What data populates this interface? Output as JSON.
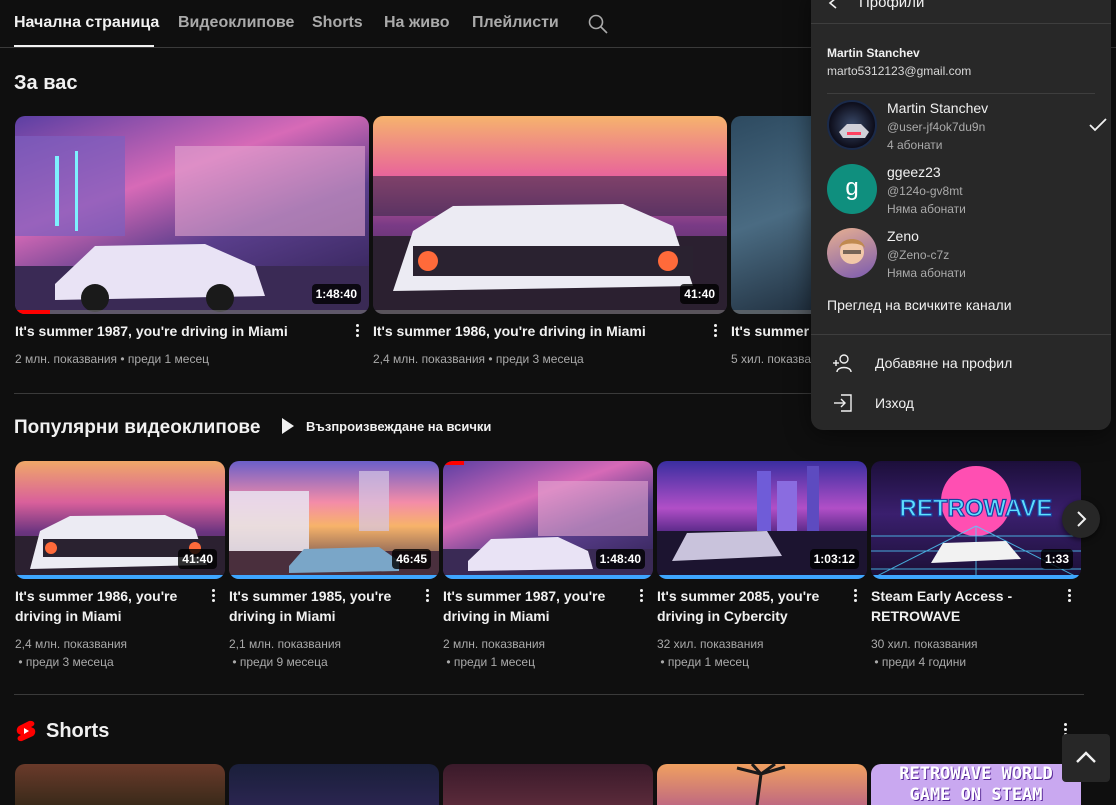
{
  "tabs": [
    "Начална страница",
    "Видеоклипове",
    "Shorts",
    "На живо",
    "Плейлисти"
  ],
  "sections": {
    "for_you": "За вас",
    "popular": "Популярни видеоклипове",
    "play_all": "Възпроизвеждане на всички",
    "shorts": "Shorts"
  },
  "for_you_videos": [
    {
      "title": "It's summer 1987, you're driving in Miami",
      "views": "2 млн. показвания",
      "age": "преди 1 месец",
      "duration": "1:48:40",
      "progress": 0.1
    },
    {
      "title": "It's summer 1986, you're driving in Miami",
      "views": "2,4 млн. показвания",
      "age": "преди 3 месеца",
      "duration": "41:40",
      "progress": 0
    },
    {
      "title": "It's summer 1",
      "views": "5 хил. показва",
      "age": "",
      "duration": "",
      "progress": 0
    }
  ],
  "popular_videos": [
    {
      "title1": "It's summer 1986, you're",
      "title2": "driving in Miami",
      "views": "2,4 млн. показвания",
      "age": "преди 3 месеца",
      "duration": "41:40"
    },
    {
      "title1": "It's summer 1985, you're",
      "title2": "driving in Miami",
      "views": "2,1 млн. показвания",
      "age": "преди 9 месеца",
      "duration": "46:45"
    },
    {
      "title1": "It's summer 1987, you're",
      "title2": "driving in Miami",
      "views": "2 млн. показвания",
      "age": "преди 1 месец",
      "duration": "1:48:40"
    },
    {
      "title1": "It's summer 2085, you're",
      "title2": "driving in Cybercity",
      "views": "32 хил. показвания",
      "age": "преди 1 месец",
      "duration": "1:03:12"
    },
    {
      "title1": "Steam Early Access -",
      "title2": "RETROWAVE",
      "views": "30 хил. показвания",
      "age": "преди 4 години",
      "duration": "1:33"
    }
  ],
  "thumb_text": {
    "retrowave": "RETROWAVE",
    "short_line1": "RETROWAVE WORLD",
    "short_line2": "GAME ON STEAM"
  },
  "popup": {
    "title": "Профили",
    "account_name": "Martin Stanchev",
    "account_email": "marto5312123@gmail.com",
    "channels": [
      {
        "name": "Martin Stanchev",
        "handle": "@user-jf4ok7du9n",
        "subs": "4 абонати",
        "selected": true
      },
      {
        "name": "ggeez23",
        "handle": "@124o-gv8mt",
        "subs": "Няма абонати",
        "avatar_letter": "g",
        "avatar_color": "#0f8f7e"
      },
      {
        "name": "Zeno",
        "handle": "@Zeno-c7z",
        "subs": "Няма абонати"
      }
    ],
    "view_all": "Преглед на всичките канали",
    "add_profile": "Добавяне на профил",
    "logout": "Изход"
  },
  "colors": {
    "accent": "#3ea6ff",
    "progress": "#ff0000",
    "background": "#0f0f0f"
  }
}
